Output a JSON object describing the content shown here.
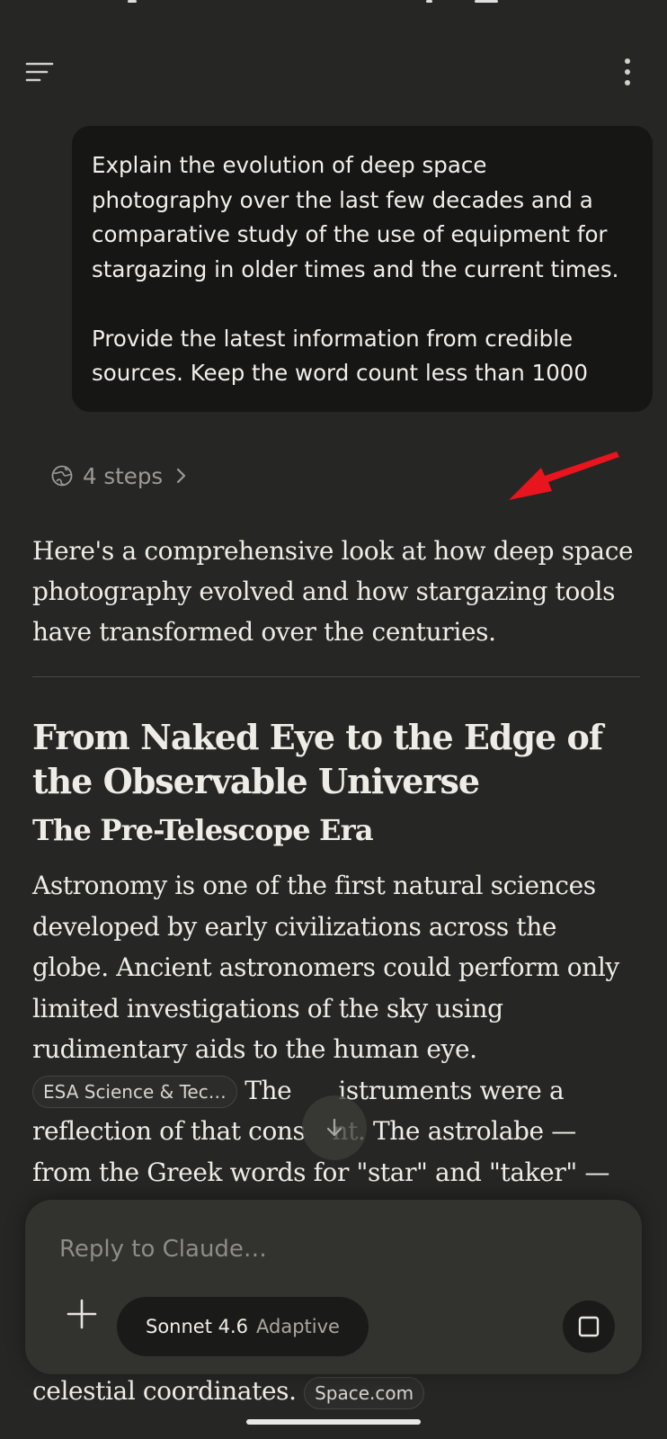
{
  "user_message": "Explain the evolution of deep space photography over the last few decades and a comparative study of the use of equipment for stargazing in older times and the current times.\n\nProvide the latest information from credible sources. Keep the word count less than 1000",
  "steps": {
    "label": "4 steps",
    "icon": "globe-icon"
  },
  "response": {
    "lead": "Here's a comprehensive look at how deep space photography evolved and how stargazing tools have transformed over the centuries.",
    "heading": "From Naked Eye to the Edge of the Observable Universe",
    "subheading": "The Pre-Telescope Era",
    "paragraph_part1": "Astronomy is one of the first natural sciences developed by early civilizations across the globe. Ancient astronomers could perform only limited investigations of the sky using rudimentary aids to the human eye.",
    "citation_1": "ESA Science & Tec…",
    "paragraph_part2_visible": "The",
    "paragraph_part2_tail": "istruments were a",
    "paragraph_part3_visible": "reflection of that cons",
    "paragraph_part3_tail": "nt. The astrolabe —",
    "paragraph_part4": "from the Greek words for \"star\" and \"taker\" —",
    "bottom_line": "celestial coordinates.",
    "citation_2": "Space.com"
  },
  "composer": {
    "placeholder": "Reply to Claude…",
    "model_name": "Sonnet 4.6",
    "model_mode": "Adaptive"
  },
  "colors": {
    "background": "#262624",
    "bubble": "#161614",
    "composer": "#32322F",
    "arrow": "#E8141E"
  }
}
